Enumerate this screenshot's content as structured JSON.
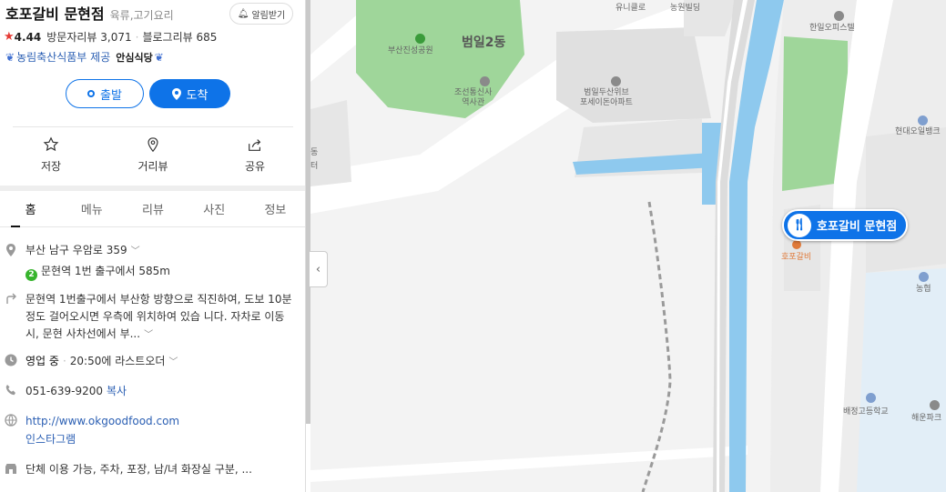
{
  "place": {
    "name": "호포갈비 문현점",
    "category": "육류,고기요리",
    "alarm_label": "알림받기",
    "rating": "4.44",
    "visitor_reviews": "방문자리뷰 3,071",
    "blog_reviews": "블로그리뷰 685",
    "badge_text": "농림축산식품부 제공",
    "badge_strong": "안심식당"
  },
  "route": {
    "depart_label": "출발",
    "arrive_label": "도착"
  },
  "actions": [
    {
      "label": "저장",
      "icon": "star-outline-icon"
    },
    {
      "label": "거리뷰",
      "icon": "location-pin-outline-icon"
    },
    {
      "label": "공유",
      "icon": "share-icon"
    }
  ],
  "tabs": [
    {
      "label": "홈",
      "active": true
    },
    {
      "label": "메뉴"
    },
    {
      "label": "리뷰"
    },
    {
      "label": "사진"
    },
    {
      "label": "정보"
    }
  ],
  "info": {
    "address": "부산 남구 우암로 359",
    "subway_line": "2",
    "subway_text": "문현역 1번 출구에서 585m",
    "directions": "문현역 1번출구에서 부산항 방향으로 직진하여, 도보 10분정도 걸어오시면 우측에 위치하여 있습 니다. 자차로 이동 시, 문현 사차선에서 부...",
    "hours_status": "영업 중",
    "hours_detail": "20:50에 라스트오더",
    "phone": "051-639-9200",
    "copy_label": "복사",
    "website": "http://www.okgoodfood.com",
    "instagram": "인스타그램",
    "amenities": "단체 이용 가능, 주차, 포장, 남/녀 화장실 구분, ..."
  },
  "map": {
    "labels": {
      "uniqlo": "유니클로",
      "nongwon": "농원빌딩",
      "hanil_office": "한일오피스텔",
      "park": "부산진성공원",
      "beomil2dong": "범일2동",
      "joseon": "조선통신사\n역사관",
      "apt": "범일두산위브\n포세이돈아파트",
      "hyundai_oil": "현대오일뱅크",
      "hopo_small": "호포갈비",
      "nonghyup": "농협",
      "baejeong": "배정고등학교",
      "haeun": "해운파크",
      "left_edge1": "동",
      "left_edge2": "터"
    },
    "pin_label": "호포갈비 문현점",
    "colors": {
      "water": "#8ec9ee",
      "park": "#9fd69a",
      "road": "#ffffff",
      "block": "#e3e3e3",
      "pin": "#0e73e8"
    }
  }
}
